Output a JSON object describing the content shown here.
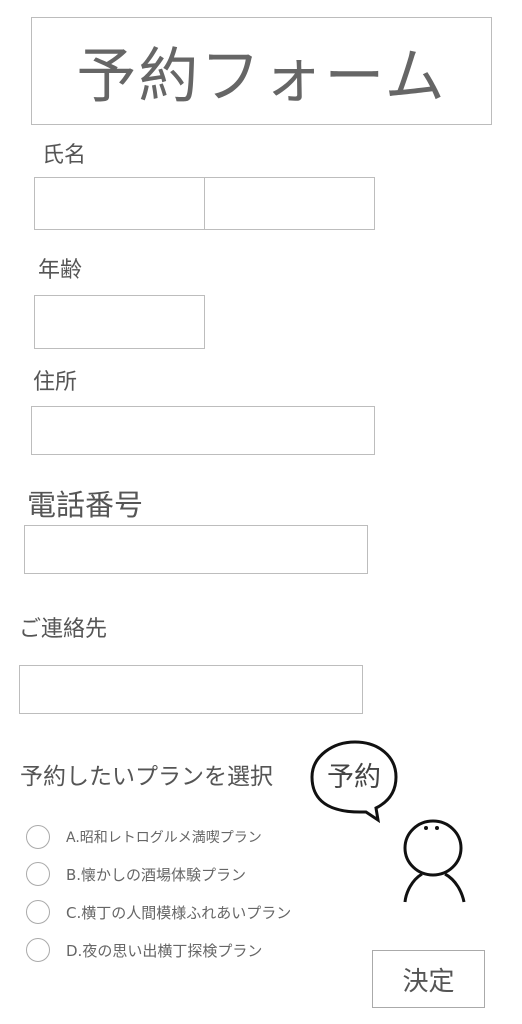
{
  "title": "予約フォーム",
  "fields": {
    "name_label": "氏名",
    "age_label": "年齢",
    "address_label": "住所",
    "phone_label": "電話番号",
    "contact_label": "ご連絡先"
  },
  "plans": {
    "heading": "予約したいプランを選択",
    "options": [
      "A.昭和レトログルメ満喫プラン",
      "B.懐かしの酒場体験プラン",
      "C.横丁の人間模様ふれあいプラン",
      "D.夜の思い出横丁探検プラン"
    ]
  },
  "mascot": {
    "speech_text": "予約"
  },
  "submit_label": "決定"
}
